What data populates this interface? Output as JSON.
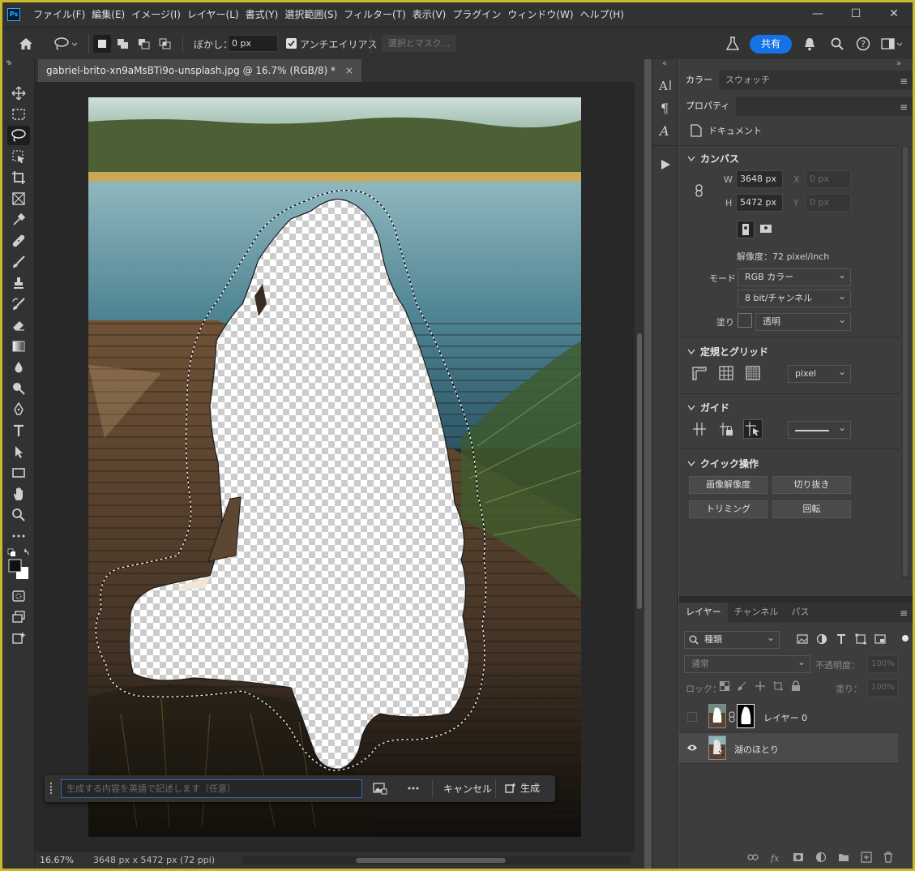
{
  "app": {
    "logo": "Ps"
  },
  "menu": [
    "ファイル(F)",
    "編集(E)",
    "イメージ(I)",
    "レイヤー(L)",
    "書式(Y)",
    "選択範囲(S)",
    "フィルター(T)",
    "表示(V)",
    "プラグイン",
    "ウィンドウ(W)",
    "ヘルプ(H)"
  ],
  "window_controls": {
    "minimize": "—",
    "maximize": "☐",
    "close": "✕"
  },
  "options": {
    "feather_label": "ぼかし：",
    "feather_value": "0 px",
    "antialias_label": "アンチエイリアス",
    "antialias_checked": true,
    "select_mask_label": "選択とマスク...",
    "share_label": "共有"
  },
  "document": {
    "tab_title": "gabriel-brito-xn9aMsBTi9o-unsplash.jpg @ 16.7% (RGB/8) *",
    "close_icon": "×"
  },
  "taskbar": {
    "prompt_placeholder": "生成する内容を英語で記述します（任意）",
    "cancel_label": "キャンセル",
    "generate_label": "生成"
  },
  "status": {
    "zoom": "16.67%",
    "info": "3648 px x 5472 px (72 ppi)"
  },
  "panels": {
    "top_tabs": [
      "カラー",
      "スウォッチ"
    ],
    "prop_tab": "プロパティ",
    "doc_label": "ドキュメント",
    "canvas": {
      "title": "カンバス",
      "w_label": "W",
      "w_value": "3648 px",
      "h_label": "H",
      "h_value": "5472 px",
      "x_label": "X",
      "x_value": "0 px",
      "y_label": "Y",
      "y_value": "0 px",
      "resolution": "解像度：72 pixel/inch",
      "mode_label": "モード",
      "mode_value": "RGB カラー",
      "depth_value": "8 bit/チャンネル",
      "fill_label": "塗り",
      "fill_value": "透明"
    },
    "rulers": {
      "title": "定規とグリッド",
      "unit": "pixel"
    },
    "guides": {
      "title": "ガイド"
    },
    "quick": {
      "title": "クイック操作",
      "buttons": [
        "画像解像度",
        "切り抜き",
        "トリミング",
        "回転"
      ]
    }
  },
  "layers": {
    "tabs": [
      "レイヤー",
      "チャンネル",
      "パス"
    ],
    "filter_kind": "種類",
    "blend_mode": "通常",
    "opacity_label": "不透明度：",
    "opacity_value": "100%",
    "lock_label": "ロック：",
    "fill_label": "塗り：",
    "fill_value": "100%",
    "items": [
      {
        "name": "レイヤー 0",
        "visible": false,
        "has_mask": true
      },
      {
        "name": "湖のほとり",
        "visible": true,
        "has_mask": false
      }
    ]
  },
  "colors": {
    "accent": "#1473e6",
    "frame": "#c9b92a",
    "selection": "#31a8ff"
  }
}
